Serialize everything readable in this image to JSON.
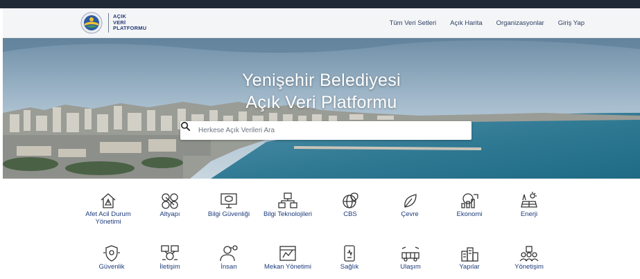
{
  "header": {
    "logo_lines": [
      "AÇIK",
      "VERİ",
      "PLATFORMU"
    ],
    "menu": [
      "Tüm Veri Setleri",
      "Açık Harita",
      "Organizasyonlar",
      "Giriş Yap"
    ]
  },
  "hero": {
    "title_line1": "Yenişehir Belediyesi",
    "title_line2": "Açık Veri Platformu",
    "search_placeholder": "Herkese Açık Verileri Ara"
  },
  "categories": [
    {
      "label": "Afet Acil Durum Yönetimi",
      "icon": "house-alert-icon"
    },
    {
      "label": "Altyapı",
      "icon": "network-pipes-icon"
    },
    {
      "label": "Bilgi Güvenliği",
      "icon": "monitor-shield-icon"
    },
    {
      "label": "Bilgi Teknolojileri",
      "icon": "tech-network-icon"
    },
    {
      "label": "CBS",
      "icon": "globe-map-icon"
    },
    {
      "label": "Çevre",
      "icon": "leaf-icon"
    },
    {
      "label": "Ekonomi",
      "icon": "economy-chart-icon"
    },
    {
      "label": "Enerji",
      "icon": "solar-energy-icon"
    },
    {
      "label": "Güvenlik",
      "icon": "security-shield-icon"
    },
    {
      "label": "İletişim",
      "icon": "communication-icon"
    },
    {
      "label": "İnsan",
      "icon": "person-icon"
    },
    {
      "label": "Mekan Yönetimi",
      "icon": "space-management-icon"
    },
    {
      "label": "Sağlık",
      "icon": "health-device-icon"
    },
    {
      "label": "Ulaşım",
      "icon": "transport-icon"
    },
    {
      "label": "Yapılar",
      "icon": "buildings-icon"
    },
    {
      "label": "Yönetişim",
      "icon": "governance-icon"
    }
  ],
  "colors": {
    "brand": "#233a78",
    "category_text": "#1c3a7a",
    "topbar": "#1f2a35"
  }
}
